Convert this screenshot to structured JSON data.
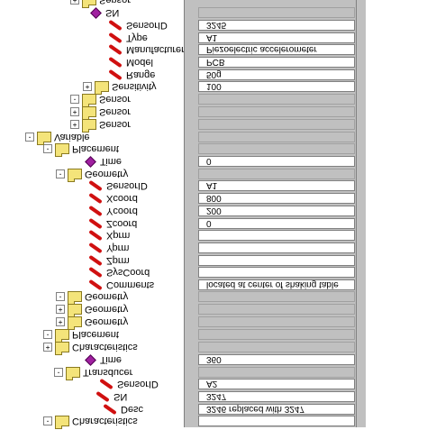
{
  "tree": [
    {
      "label": "Characteristics",
      "icon": "folder-icon",
      "exp": "-"
    },
    {
      "label": "Desc",
      "icon": "property-pen-icon"
    },
    {
      "label": "SN",
      "icon": "property-pen-icon"
    },
    {
      "label": "SensorID",
      "icon": "property-pen-icon"
    },
    {
      "label": "Transducer",
      "icon": "folder-icon",
      "exp": "-"
    },
    {
      "label": "Time",
      "icon": "time-diamond-icon"
    },
    {
      "label": "Characteristics",
      "icon": "folder-icon",
      "exp": "+"
    },
    {
      "label": "Placement",
      "icon": "folder-icon",
      "exp": "-"
    },
    {
      "label": "Geometry",
      "icon": "folder-icon",
      "exp": "+"
    },
    {
      "label": "Geometry",
      "icon": "folder-icon",
      "exp": "+"
    },
    {
      "label": "Geometry",
      "icon": "folder-icon",
      "exp": "-"
    },
    {
      "label": "Comments",
      "icon": "property-pen-icon"
    },
    {
      "label": "SysCoord",
      "icon": "property-pen-icon"
    },
    {
      "label": "Zprm",
      "icon": "property-pen-icon"
    },
    {
      "label": "Yprm",
      "icon": "property-pen-icon"
    },
    {
      "label": "Xprm",
      "icon": "property-pen-icon"
    },
    {
      "label": "Zcoord",
      "icon": "property-pen-icon"
    },
    {
      "label": "Ycoord",
      "icon": "property-pen-icon"
    },
    {
      "label": "Xcoord",
      "icon": "property-pen-icon"
    },
    {
      "label": "SensorID",
      "icon": "property-pen-icon"
    },
    {
      "label": "Geometry",
      "icon": "folder-icon",
      "exp": "-"
    },
    {
      "label": "Time",
      "icon": "time-diamond-icon"
    },
    {
      "label": "Placement",
      "icon": "folder-icon",
      "exp": "-"
    },
    {
      "label": "Variable",
      "icon": "folder-icon",
      "exp": "-"
    },
    {
      "label": "Sensor",
      "icon": "folder-icon",
      "exp": "+"
    },
    {
      "label": "Sensor",
      "icon": "folder-icon",
      "exp": "+"
    },
    {
      "label": "Sensor",
      "icon": "folder-icon",
      "exp": "-"
    },
    {
      "label": "Sensitivity",
      "icon": "folder-icon",
      "exp": "+"
    },
    {
      "label": "Range",
      "icon": "property-pen-icon"
    },
    {
      "label": "Model",
      "icon": "property-pen-icon"
    },
    {
      "label": "Manufacturer",
      "icon": "property-pen-icon"
    },
    {
      "label": "Type",
      "icon": "property-pen-icon"
    },
    {
      "label": "SensorID",
      "icon": "property-pen-icon"
    },
    {
      "label": "SN",
      "icon": "time-diamond-icon"
    },
    {
      "label": "Sensor",
      "icon": "folder-icon",
      "exp": "+"
    }
  ],
  "grid": [
    {
      "value": ""
    },
    {
      "value": "3246 replaced with 3247"
    },
    {
      "value": "3247"
    },
    {
      "value": "A2"
    },
    {
      "value": null
    },
    {
      "value": "360"
    },
    {
      "value": null
    },
    {
      "value": null
    },
    {
      "value": null
    },
    {
      "value": null
    },
    {
      "value": null
    },
    {
      "value": "located at center of shaking table"
    },
    {
      "value": ""
    },
    {
      "value": ""
    },
    {
      "value": ""
    },
    {
      "value": ""
    },
    {
      "value": "0"
    },
    {
      "value": "200"
    },
    {
      "value": "800"
    },
    {
      "value": "A1"
    },
    {
      "value": null
    },
    {
      "value": "0"
    },
    {
      "value": null
    },
    {
      "value": null
    },
    {
      "value": null
    },
    {
      "value": null
    },
    {
      "value": null
    },
    {
      "value": "100"
    },
    {
      "value": "50g"
    },
    {
      "value": "PCB"
    },
    {
      "value": "Piezoelectric accelerometer"
    },
    {
      "value": "A1"
    },
    {
      "value": "3245"
    },
    {
      "value": null
    }
  ]
}
